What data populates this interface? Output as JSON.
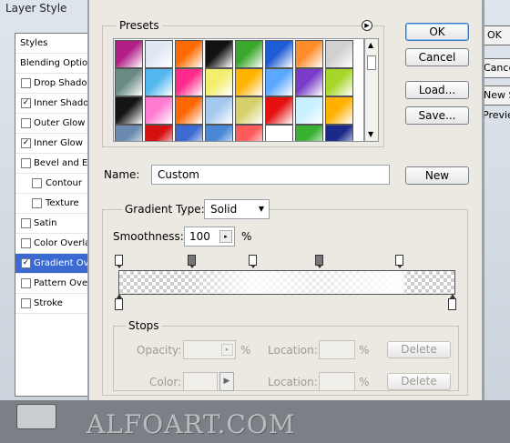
{
  "background_window": {
    "title": "Layer Style",
    "styles_header": "Styles",
    "items": [
      {
        "label": "Blending Options",
        "checked": null,
        "selected": false,
        "indent": false
      },
      {
        "label": "Drop Shadow",
        "checked": false,
        "selected": false,
        "indent": false
      },
      {
        "label": "Inner Shadow",
        "checked": true,
        "selected": false,
        "indent": false
      },
      {
        "label": "Outer Glow",
        "checked": false,
        "selected": false,
        "indent": false
      },
      {
        "label": "Inner Glow",
        "checked": true,
        "selected": false,
        "indent": false
      },
      {
        "label": "Bevel and Emboss",
        "checked": false,
        "selected": false,
        "indent": false
      },
      {
        "label": "Contour",
        "checked": false,
        "selected": false,
        "indent": true
      },
      {
        "label": "Texture",
        "checked": false,
        "selected": false,
        "indent": true
      },
      {
        "label": "Satin",
        "checked": false,
        "selected": false,
        "indent": false
      },
      {
        "label": "Color Overlay",
        "checked": false,
        "selected": false,
        "indent": false
      },
      {
        "label": "Gradient Overlay",
        "checked": true,
        "selected": true,
        "indent": false
      },
      {
        "label": "Pattern Overlay",
        "checked": false,
        "selected": false,
        "indent": false
      },
      {
        "label": "Stroke",
        "checked": false,
        "selected": false,
        "indent": false
      }
    ],
    "right_partial": [
      "OK",
      "Cancel",
      "New Style",
      "Preview"
    ]
  },
  "watermark": "ALFOART.COM",
  "dialog": {
    "presets_label": "Presets",
    "buttons": {
      "ok": "OK",
      "cancel": "Cancel",
      "load": "Load...",
      "save": "Save...",
      "new": "New"
    },
    "name_label": "Name:",
    "name_value": "Custom",
    "gradient_type_label": "Gradient Type:",
    "gradient_type_value": "Solid",
    "smoothness_label": "Smoothness:",
    "smoothness_value": "100",
    "smoothness_unit": "%",
    "stops": {
      "group_label": "Stops",
      "opacity_label": "Opacity:",
      "opacity_unit": "%",
      "color_label": "Color:",
      "location_label": "Location:",
      "location_unit": "%",
      "delete_label": "Delete"
    },
    "presets": [
      [
        "#b21e86",
        "#e0e8f4",
        "#ff6a00",
        "#111111",
        "#3aa82c",
        "#1e5cd6",
        "#ff8c2a",
        "#d0d0d0"
      ],
      [
        "#6a8a84",
        "#52b7ef",
        "#ff2a8c",
        "#f3ee6e",
        "#ffb400",
        "#5aa8ff",
        "#7a3cc8",
        "#a6d62a"
      ],
      [
        "#141414",
        "#ff7ad0",
        "#ff6600",
        "#a4c8ee",
        "#d6d06a",
        "#e61010",
        "#c8f0ff",
        "#ffb000"
      ],
      [
        "#6a8ab0",
        "#d41010",
        "#3a6ad2",
        "#4a88d6",
        "#ff5a5a",
        "#ffffff",
        "#38b030",
        "#1a2a88"
      ]
    ],
    "colors": {
      "selected_stop": "#777777",
      "accent": "#3a78c8"
    }
  }
}
